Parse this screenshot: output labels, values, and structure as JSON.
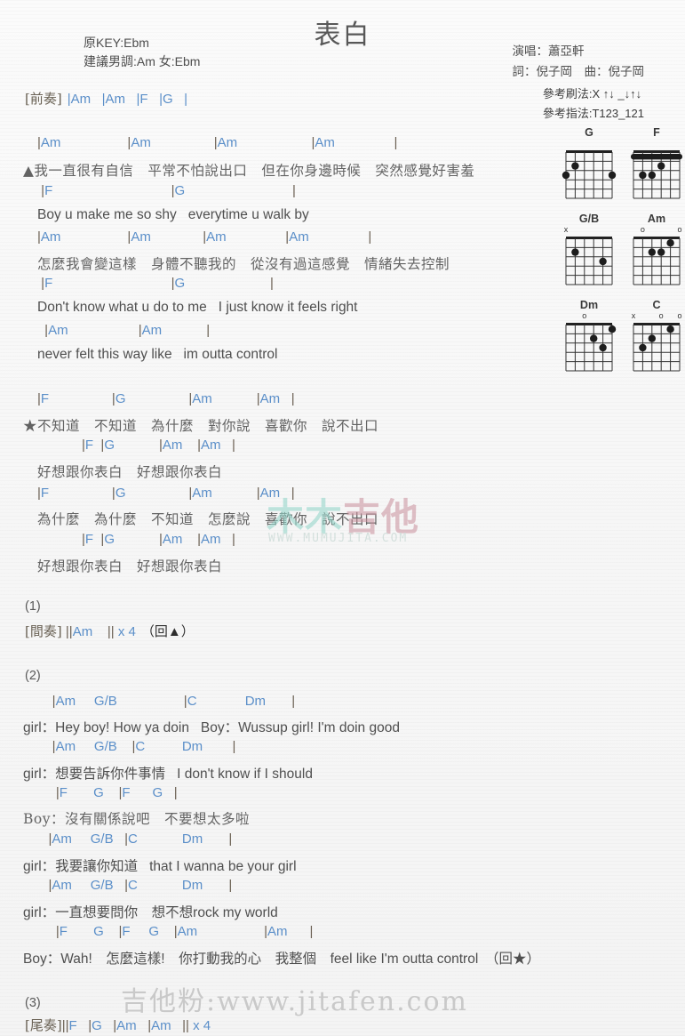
{
  "header": {
    "title": "表白",
    "orig_key": "原KEY:Ebm",
    "suggest_key": "建議男調:Am 女:Ebm",
    "singer": "演唱：蕭亞軒",
    "writers": "詞：倪子岡　曲：倪子岡",
    "strum_ref": "參考刷法:X ↑↓ _↓↑↓",
    "finger_ref": "參考指法:T123_121"
  },
  "intro": {
    "label": "[前奏]",
    "chords": "|Am   |Am   |F   |G   |"
  },
  "sections": [
    {
      "name": "verse-1",
      "lines": [
        {
          "type": "chord",
          "text": "|Am                  |Am                 |Am                    |Am                |"
        },
        {
          "type": "lyric",
          "lang": "cn",
          "text": "▲我一直很有自信　平常不怕說出口　但在你身邊時候　突然感覺好害羞"
        },
        {
          "type": "chord",
          "text": " |F                                |G                             |"
        },
        {
          "type": "lyric",
          "lang": "en",
          "text": "Boy u make me so shy   everytime u walk by"
        },
        {
          "type": "chord",
          "text": "|Am                  |Am              |Am                |Am                |"
        },
        {
          "type": "lyric",
          "lang": "cn",
          "text": "怎麼我會變這樣　身體不聽我的　從沒有過這感覺　情緒失去控制"
        },
        {
          "type": "chord",
          "text": " |F                                |G                       |"
        },
        {
          "type": "lyric",
          "lang": "en",
          "text": "Don't know what u do to me   I just know it feels right"
        },
        {
          "type": "chord",
          "text": " |Am                   |Am            |"
        },
        {
          "type": "lyric",
          "lang": "en",
          "text": "never felt this way like   im outta control"
        }
      ]
    },
    {
      "name": "chorus-1",
      "lines": [
        {
          "type": "chord",
          "text": "|F                 |G                 |Am            |Am   |"
        },
        {
          "type": "lyric",
          "lang": "cn",
          "text": "★不知道　不知道　為什麼　對你說　喜歡你　說不出口"
        },
        {
          "type": "chord",
          "text": "            |F  |G            |Am    |Am   |"
        },
        {
          "type": "lyric",
          "lang": "cn",
          "text": "好想跟你表白　好想跟你表白"
        },
        {
          "type": "chord",
          "text": "|F                 |G                 |Am            |Am   |"
        },
        {
          "type": "lyric",
          "lang": "cn",
          "text": "為什麼　為什麼　不知道　怎麼說　喜歡你　說不出口"
        },
        {
          "type": "chord",
          "text": "            |F  |G            |Am    |Am   |"
        },
        {
          "type": "lyric",
          "lang": "cn",
          "text": "好想跟你表白　好想跟你表白"
        }
      ]
    }
  ],
  "interlude": {
    "number": "(1)",
    "label": "[間奏]",
    "chords": "||Am    || x 4",
    "repeat": "（回▲）"
  },
  "section2": {
    "number": "(2)",
    "lines": [
      {
        "type": "chord",
        "text": "    |Am     G/B                  |C             Dm       |"
      },
      {
        "type": "lyric",
        "lang": "en",
        "text": "girl：Hey boy! How ya doin   Boy：Wussup girl! I'm doin good"
      },
      {
        "type": "chord",
        "text": "    |Am     G/B    |C          Dm        |"
      },
      {
        "type": "lyric",
        "lang": "mix",
        "text": "girl：想要告訴你件事情   I don't know if I should"
      },
      {
        "type": "chord",
        "text": "     |F       G    |F      G   |"
      },
      {
        "type": "lyric",
        "lang": "cn",
        "text": "Boy：沒有關係說吧　不要想太多啦"
      },
      {
        "type": "chord",
        "text": "   |Am     G/B   |C            Dm       |"
      },
      {
        "type": "lyric",
        "lang": "mix",
        "text": "girl：我要讓你知道   that I wanna be your girl"
      },
      {
        "type": "chord",
        "text": "   |Am     G/B   |C            Dm       |"
      },
      {
        "type": "lyric",
        "lang": "mix",
        "text": "girl：一直想要問你　想不想rock my world"
      },
      {
        "type": "chord",
        "text": "     |F       G    |F     G    |Am                  |Am      |"
      },
      {
        "type": "lyric",
        "lang": "mix",
        "text": "Boy：Wah!　怎麼這樣!　你打動我的心　我整個　feel like I'm outta control　（回★）"
      }
    ]
  },
  "outro": {
    "number": "(3)",
    "label": "[尾奏]",
    "chords": "||F   |G   |Am   |Am   || x 4"
  },
  "watermarks": {
    "mumu_part1": "木木",
    "mumu_part2": "吉他",
    "mumu_url": "WWW.MUMUJITA.COM",
    "jitafen": "吉他粉:www.jitafen.com"
  },
  "chord_diagrams": [
    {
      "name": "G",
      "markers": [],
      "dots": [
        {
          "string": 6,
          "fret": 3
        },
        {
          "string": 5,
          "fret": 2
        },
        {
          "string": 1,
          "fret": 3
        }
      ],
      "barre": null
    },
    {
      "name": "F",
      "markers": [],
      "dots": [
        {
          "string": 3,
          "fret": 2
        },
        {
          "string": 4,
          "fret": 3
        },
        {
          "string": 5,
          "fret": 3
        }
      ],
      "barre": {
        "fret": 1,
        "from": 6,
        "to": 1
      }
    },
    {
      "name": "G/B",
      "markers": [
        {
          "string": 6,
          "symbol": "x"
        }
      ],
      "dots": [
        {
          "string": 5,
          "fret": 2
        },
        {
          "string": 2,
          "fret": 3
        }
      ],
      "barre": null
    },
    {
      "name": "Am",
      "markers": [
        {
          "string": 5,
          "symbol": "o"
        },
        {
          "string": 1,
          "symbol": "o"
        }
      ],
      "dots": [
        {
          "string": 2,
          "fret": 1
        },
        {
          "string": 4,
          "fret": 2
        },
        {
          "string": 3,
          "fret": 2
        }
      ],
      "barre": null
    },
    {
      "name": "Dm",
      "markers": [
        {
          "string": 4,
          "symbol": "o"
        }
      ],
      "dots": [
        {
          "string": 1,
          "fret": 1
        },
        {
          "string": 3,
          "fret": 2
        },
        {
          "string": 2,
          "fret": 3
        }
      ],
      "barre": null
    },
    {
      "name": "C",
      "markers": [
        {
          "string": 6,
          "symbol": "x"
        },
        {
          "string": 3,
          "symbol": "o"
        },
        {
          "string": 1,
          "symbol": "o"
        }
      ],
      "dots": [
        {
          "string": 2,
          "fret": 1
        },
        {
          "string": 4,
          "fret": 2
        },
        {
          "string": 5,
          "fret": 3
        }
      ],
      "barre": null
    }
  ],
  "colors": {
    "chord": "#5b8fc9",
    "bar": "#6a5f52",
    "lyric": "#5a5a5a",
    "title": "#585858"
  }
}
